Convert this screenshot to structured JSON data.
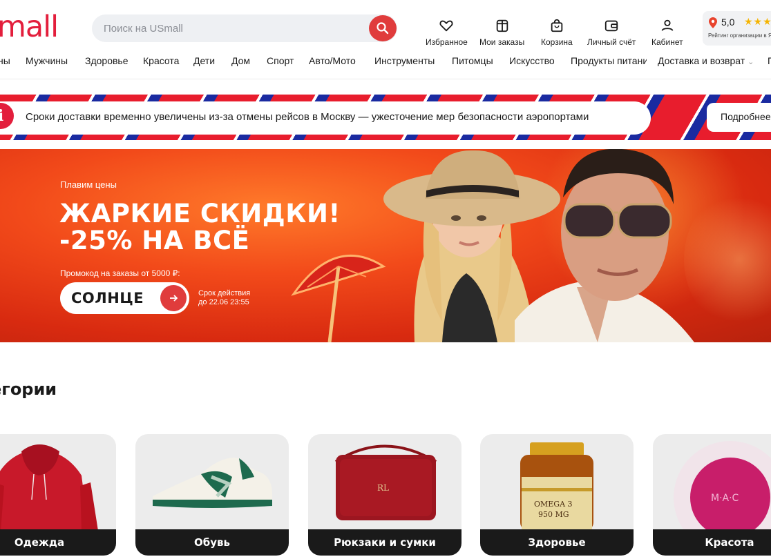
{
  "header": {
    "logo": "mall",
    "search_placeholder": "Поиск на USmall",
    "icons": [
      {
        "label": "Избранное",
        "icon": "heart-icon"
      },
      {
        "label": "Мои заказы",
        "icon": "orders-icon"
      },
      {
        "label": "Корзина",
        "icon": "cart-bag-icon"
      },
      {
        "label": "Личный счёт",
        "icon": "wallet-icon"
      },
      {
        "label": "Кабинет",
        "icon": "user-icon"
      }
    ],
    "rating": {
      "value": "5,0",
      "stars": "★★★",
      "caption": "Рейтинг организации в Я"
    }
  },
  "nav": [
    "ны",
    "Мужчины",
    "Здоровье",
    "Красота",
    "Дети",
    "Дом",
    "Спорт",
    "Авто/Мото",
    "Инструменты",
    "Питомцы",
    "Искусство",
    "Продукты питани",
    "Доставка и возврат",
    "П"
  ],
  "notice": {
    "text": "Сроки доставки временно увеличены из-за отмены рейсов в Москву — ужесточение мер безопасности аэропортами",
    "button": "Подробнее"
  },
  "banner": {
    "small": "Плавим цены",
    "title_line1": "ЖАРКИЕ СКИДКИ!",
    "title_line2": "-25% НА ВСЁ",
    "promo_label": "Промокод на заказы от 5000 ₽:",
    "promo_code": "СОЛНЦЕ",
    "valid_line1": "Срок действия",
    "valid_line2": "до 22.06 23:55"
  },
  "categories": {
    "title": "егории",
    "items": [
      "Одежда",
      "Обувь",
      "Рюкзаки и сумки",
      "Здоровье",
      "Красота"
    ]
  },
  "colors": {
    "brand": "#e31e3c",
    "accent": "#e03c3c",
    "banner": "#f24a1a"
  }
}
